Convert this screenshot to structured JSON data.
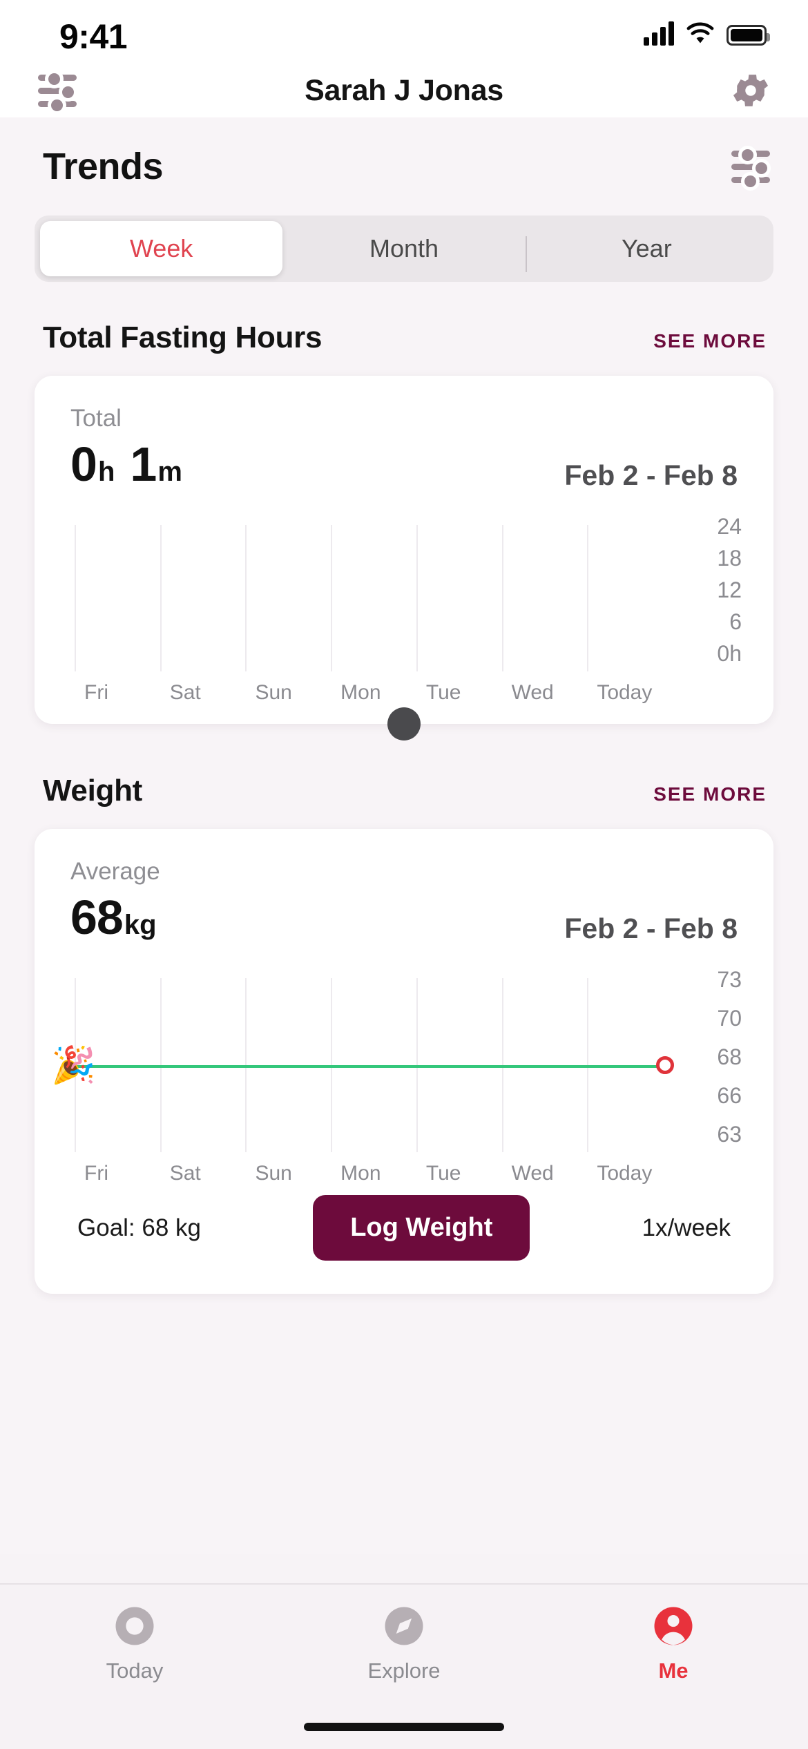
{
  "status_bar": {
    "time": "9:41",
    "signal_icon": "cellular-bars-icon",
    "wifi_icon": "wifi-icon",
    "battery_icon": "battery-full-icon"
  },
  "nav": {
    "title": "Sarah J Jonas",
    "left_icon": "filter-sliders-icon",
    "right_icon": "gear-icon"
  },
  "trends": {
    "title": "Trends",
    "filter_icon": "filter-sliders-icon",
    "tabs": [
      {
        "label": "Week",
        "active": true
      },
      {
        "label": "Month",
        "active": false
      },
      {
        "label": "Year",
        "active": false
      }
    ],
    "active_color": "#E04450"
  },
  "fasting": {
    "heading": "Total Fasting Hours",
    "see_more": "SEE MORE",
    "stat_label": "Total",
    "hours_value": "0",
    "hours_unit": "h",
    "minutes_value": "1",
    "minutes_unit": "m",
    "date_range": "Feb 2 - Feb 8"
  },
  "weight": {
    "heading": "Weight",
    "see_more": "SEE MORE",
    "stat_label": "Average",
    "value": "68",
    "unit": "kg",
    "date_range": "Feb 2 - Feb 8",
    "goal_text": "Goal: 68 kg",
    "log_button": "Log Weight",
    "frequency": "1x/week",
    "celebration_icon": "party-popper-icon",
    "marker_icon": "weight-point-marker-icon",
    "goal_line_color": "#34C77B",
    "marker_color": "#E0333A",
    "button_color": "#6D0B3C"
  },
  "tabbar": {
    "items": [
      {
        "label": "Today",
        "icon": "circle-today-icon",
        "active": false
      },
      {
        "label": "Explore",
        "icon": "compass-icon",
        "active": false
      },
      {
        "label": "Me",
        "icon": "person-icon",
        "active": true
      }
    ],
    "active_color": "#E8323C",
    "inactive_color": "#B6AFB4"
  },
  "chart_data": [
    {
      "type": "bar",
      "title": "Total Fasting Hours",
      "categories": [
        "Fri",
        "Sat",
        "Sun",
        "Mon",
        "Tue",
        "Wed",
        "Today"
      ],
      "values": [
        0,
        0,
        0,
        0,
        0,
        0,
        0
      ],
      "ytick_labels": [
        "24",
        "18",
        "12",
        "6",
        "0h"
      ],
      "yticks": [
        24,
        18,
        12,
        6,
        0
      ],
      "ylim": [
        0,
        24
      ],
      "ylabel": "",
      "xlabel": "",
      "grid": true,
      "legend": "none"
    },
    {
      "type": "line",
      "title": "Weight",
      "categories": [
        "Fri",
        "Sat",
        "Sun",
        "Mon",
        "Tue",
        "Wed",
        "Today"
      ],
      "series": [
        {
          "name": "Goal",
          "values": [
            68,
            68,
            68,
            68,
            68,
            68,
            68
          ],
          "color": "#34C77B"
        }
      ],
      "points": [
        {
          "x": "Today",
          "y": 68
        }
      ],
      "ytick_labels": [
        "73",
        "70",
        "68",
        "66",
        "63"
      ],
      "yticks": [
        73,
        70,
        68,
        66,
        63
      ],
      "ylim": [
        63,
        73
      ],
      "ylabel": "",
      "xlabel": "",
      "grid": true,
      "legend": "none"
    }
  ]
}
